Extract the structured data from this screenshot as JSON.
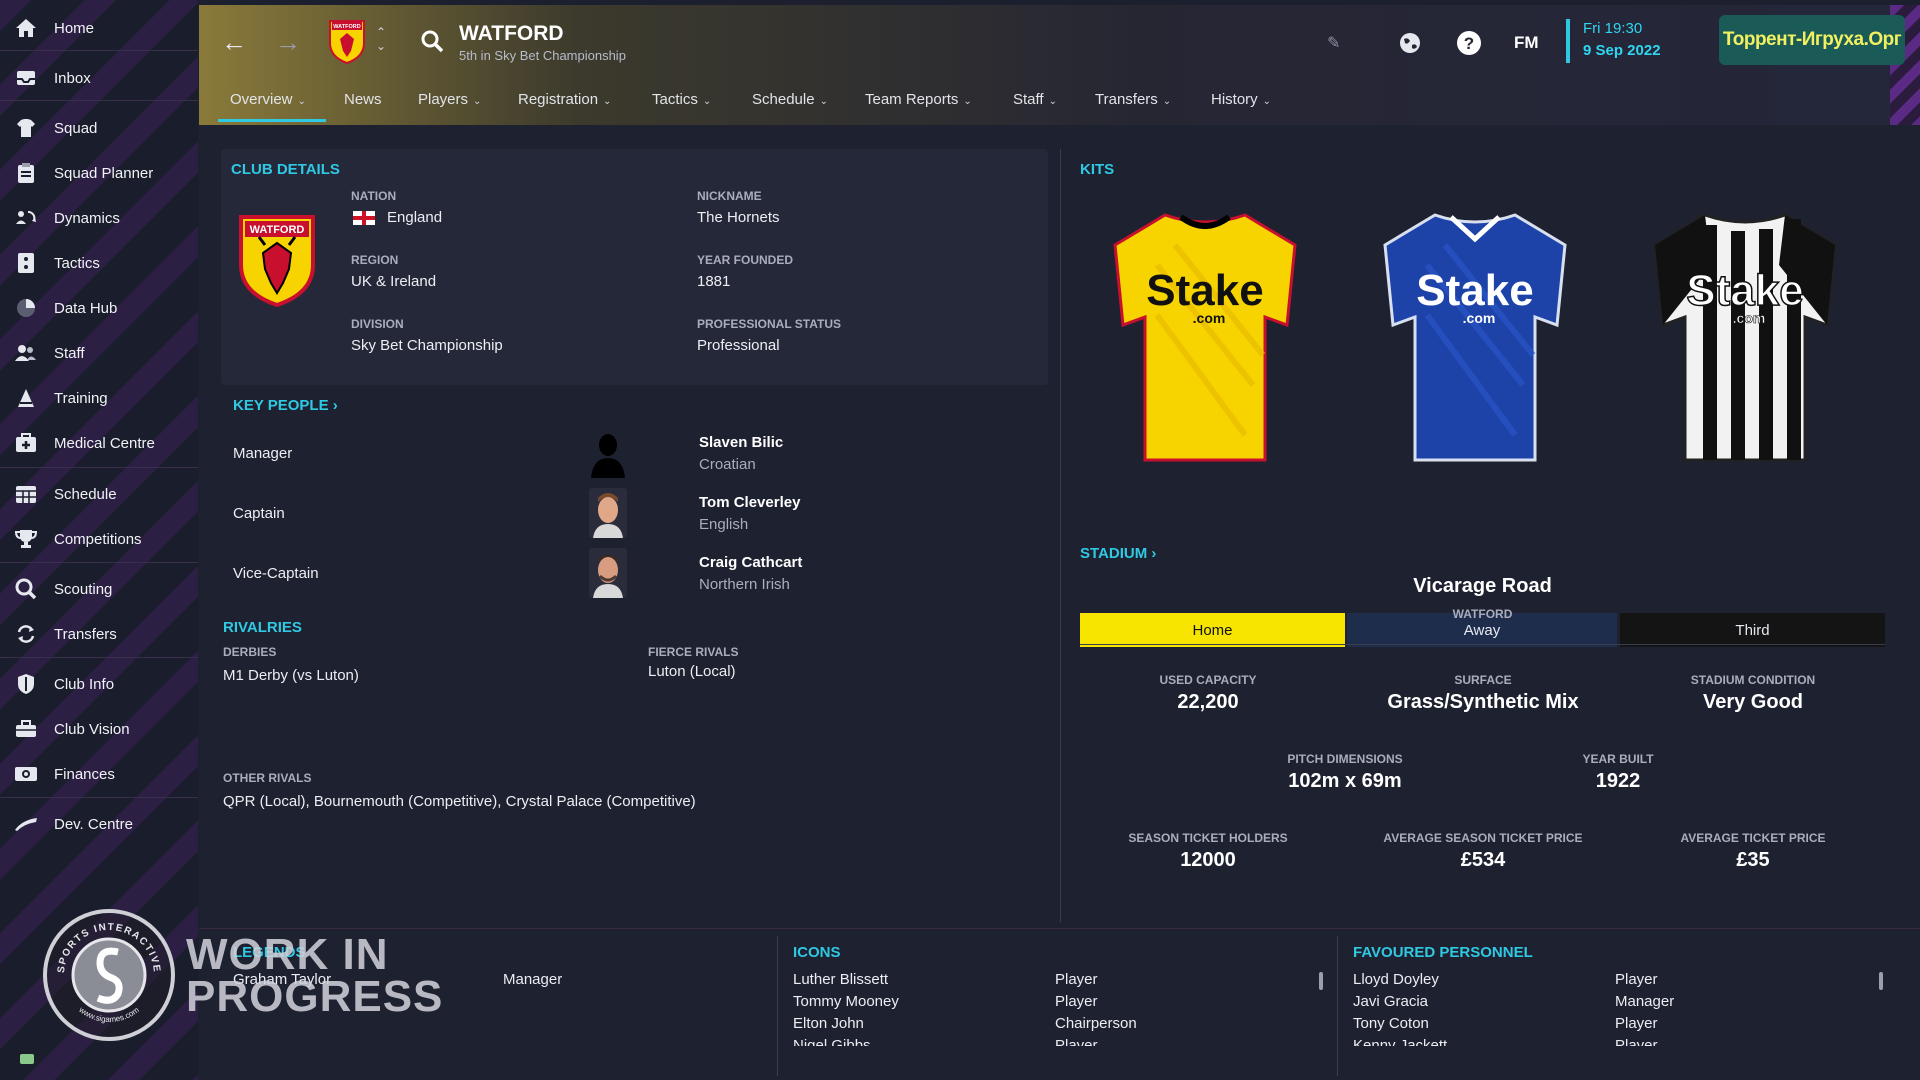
{
  "sidebar": {
    "items": [
      {
        "label": "Home",
        "icon": "home-icon"
      },
      {
        "label": "Inbox",
        "icon": "inbox-icon"
      },
      {
        "label": "Squad",
        "icon": "squad-icon"
      },
      {
        "label": "Squad Planner",
        "icon": "clipboard-icon"
      },
      {
        "label": "Dynamics",
        "icon": "dynamics-icon"
      },
      {
        "label": "Tactics",
        "icon": "tactics-icon"
      },
      {
        "label": "Data Hub",
        "icon": "data-hub-icon"
      },
      {
        "label": "Staff",
        "icon": "staff-icon"
      },
      {
        "label": "Training",
        "icon": "training-icon"
      },
      {
        "label": "Medical Centre",
        "icon": "medical-icon"
      },
      {
        "label": "Schedule",
        "icon": "calendar-icon"
      },
      {
        "label": "Competitions",
        "icon": "trophy-icon"
      },
      {
        "label": "Scouting",
        "icon": "search-icon"
      },
      {
        "label": "Transfers",
        "icon": "transfer-icon"
      },
      {
        "label": "Club Info",
        "icon": "shield-icon"
      },
      {
        "label": "Club Vision",
        "icon": "briefcase-icon"
      },
      {
        "label": "Finances",
        "icon": "money-icon"
      },
      {
        "label": "Dev. Centre",
        "icon": "dev-centre-icon"
      }
    ]
  },
  "header": {
    "title": "WATFORD",
    "subtitle": "5th in Sky Bet Championship",
    "fm": "FM",
    "time": "Fri 19:30",
    "date": "9 Sep 2022",
    "watermark": "Торрент-Игруха.Орг",
    "crest_text": "WATFORD"
  },
  "tabs": [
    "Overview",
    "News",
    "Players",
    "Registration",
    "Tactics",
    "Schedule",
    "Team Reports",
    "Staff",
    "Transfers",
    "History"
  ],
  "club_details": {
    "heading": "CLUB DETAILS",
    "crest_text": "WATFORD",
    "nation_label": "NATION",
    "nation": "England",
    "nickname_label": "NICKNAME",
    "nickname": "The Hornets",
    "region_label": "REGION",
    "region": "UK & Ireland",
    "founded_label": "YEAR FOUNDED",
    "founded": "1881",
    "division_label": "DIVISION",
    "division": "Sky Bet Championship",
    "status_label": "PROFESSIONAL STATUS",
    "status": "Professional"
  },
  "key_people": {
    "heading": "KEY PEOPLE",
    "people": [
      {
        "role": "Manager",
        "name": "Slaven Bilic",
        "nationality": "Croatian"
      },
      {
        "role": "Captain",
        "name": "Tom Cleverley",
        "nationality": "English"
      },
      {
        "role": "Vice-Captain",
        "name": "Craig Cathcart",
        "nationality": "Northern Irish"
      }
    ]
  },
  "rivalries": {
    "heading": "RIVALRIES",
    "derbies_label": "DERBIES",
    "derbies": "M1 Derby (vs Luton)",
    "fierce_label": "FIERCE RIVALS",
    "fierce": "Luton (Local)",
    "other_label": "OTHER RIVALS",
    "other": "QPR (Local), Bournemouth (Competitive), Crystal Palace (Competitive)"
  },
  "kits": {
    "heading": "KITS",
    "sponsor": "Stake",
    "sponsor_sub": ".com",
    "buttons": [
      "Home",
      "Away",
      "Third"
    ]
  },
  "stadium": {
    "heading": "STADIUM",
    "name": "Vicarage Road",
    "city": "WATFORD",
    "stats": [
      {
        "label": "USED CAPACITY",
        "value": "22,200"
      },
      {
        "label": "SURFACE",
        "value": "Grass/Synthetic Mix"
      },
      {
        "label": "STADIUM CONDITION",
        "value": "Very Good"
      },
      {
        "label": "PITCH DIMENSIONS",
        "value": "102m x 69m"
      },
      {
        "label": "YEAR BUILT",
        "value": "1922"
      },
      {
        "label": "SEASON TICKET HOLDERS",
        "value": "12000"
      },
      {
        "label": "AVERAGE SEASON TICKET PRICE",
        "value": "£534"
      },
      {
        "label": "AVERAGE TICKET PRICE",
        "value": "£35"
      }
    ]
  },
  "legends": {
    "heading": "LEGENDS",
    "rows": [
      {
        "name": "Graham Taylor",
        "role": "Manager"
      }
    ]
  },
  "icons": {
    "heading": "ICONS",
    "rows": [
      {
        "name": "Luther Blissett",
        "role": "Player"
      },
      {
        "name": "Tommy Mooney",
        "role": "Player"
      },
      {
        "name": "Elton John",
        "role": "Chairperson"
      },
      {
        "name": "Nigel Gibbs",
        "role": "Player"
      }
    ]
  },
  "favoured": {
    "heading": "FAVOURED PERSONNEL",
    "rows": [
      {
        "name": "Lloyd Doyley",
        "role": "Player"
      },
      {
        "name": "Javi Gracia",
        "role": "Manager"
      },
      {
        "name": "Tony Coton",
        "role": "Player"
      },
      {
        "name": "Kenny Jackett",
        "role": "Player"
      }
    ]
  },
  "overlay": {
    "line1": "WORK IN",
    "line2": "PROGRESS",
    "badge_top": "SPORTS INTERACTIVE",
    "badge_bottom": "www.sigames.com"
  },
  "colors": {
    "accent": "#2fc9e4",
    "home_kit": "#f7e500",
    "away_kit": "#1f2d4d",
    "third_kit": "#141414"
  }
}
